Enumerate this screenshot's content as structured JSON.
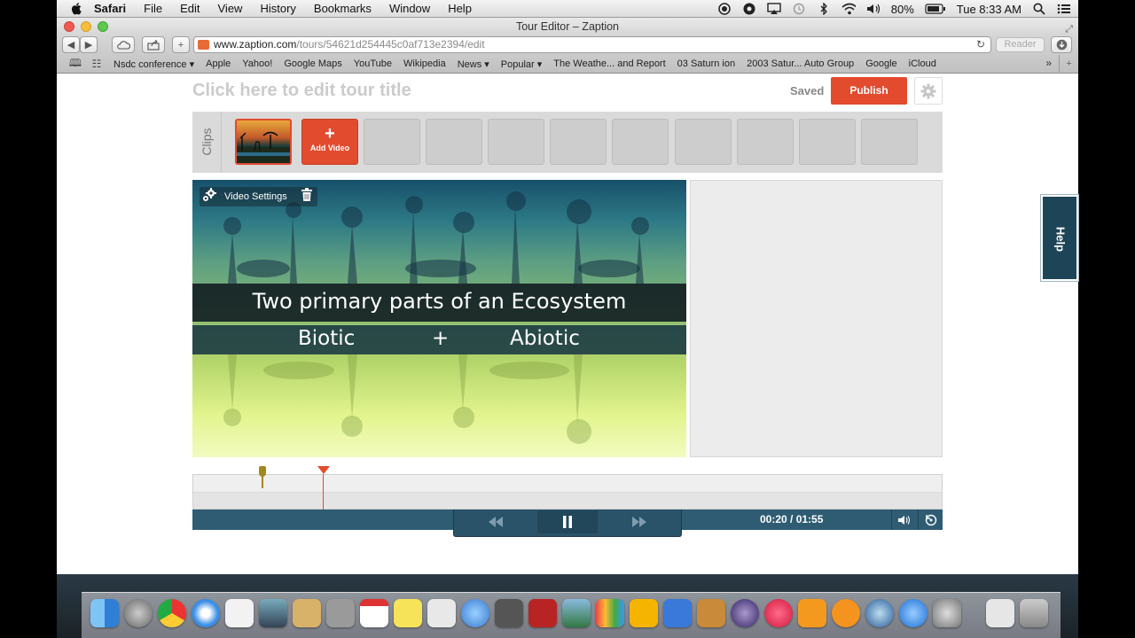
{
  "menubar": {
    "items": [
      "Safari",
      "File",
      "Edit",
      "View",
      "History",
      "Bookmarks",
      "Window",
      "Help"
    ],
    "battery": "80%",
    "clock": "Tue 8:33 AM"
  },
  "browser": {
    "window_title": "Tour Editor – Zaption",
    "url_domain": "www.zaption.com",
    "url_path": "/tours/54621d254445c0af713e2394/edit",
    "reader_label": "Reader",
    "bookmarks": [
      "Nsdc conference ▾",
      "Apple",
      "Yahoo!",
      "Google Maps",
      "YouTube",
      "Wikipedia",
      "News ▾",
      "Popular ▾",
      "The Weathe... and Report",
      "03 Saturn ion",
      "2003 Satur... Auto Group",
      "Google",
      "iCloud"
    ]
  },
  "editor": {
    "tour_title_placeholder": "Click here to edit tour title",
    "saved_label": "Saved",
    "publish_label": "Publish",
    "clips_label": "Clips",
    "add_video_label": "Add Video",
    "add_video_plus": "+",
    "video_settings_label": "Video Settings",
    "help_label": "Help"
  },
  "video": {
    "heading": "Two primary parts of an Ecosystem",
    "word_left": "Biotic",
    "word_mid": "+",
    "word_right": "Abiotic"
  },
  "player": {
    "time_display": "00:20 / 01:55",
    "elapsed_fraction": 0.174
  },
  "colors": {
    "accent": "#e24b2e",
    "controls": "#2f5c73",
    "help_tab": "#1e4457"
  }
}
